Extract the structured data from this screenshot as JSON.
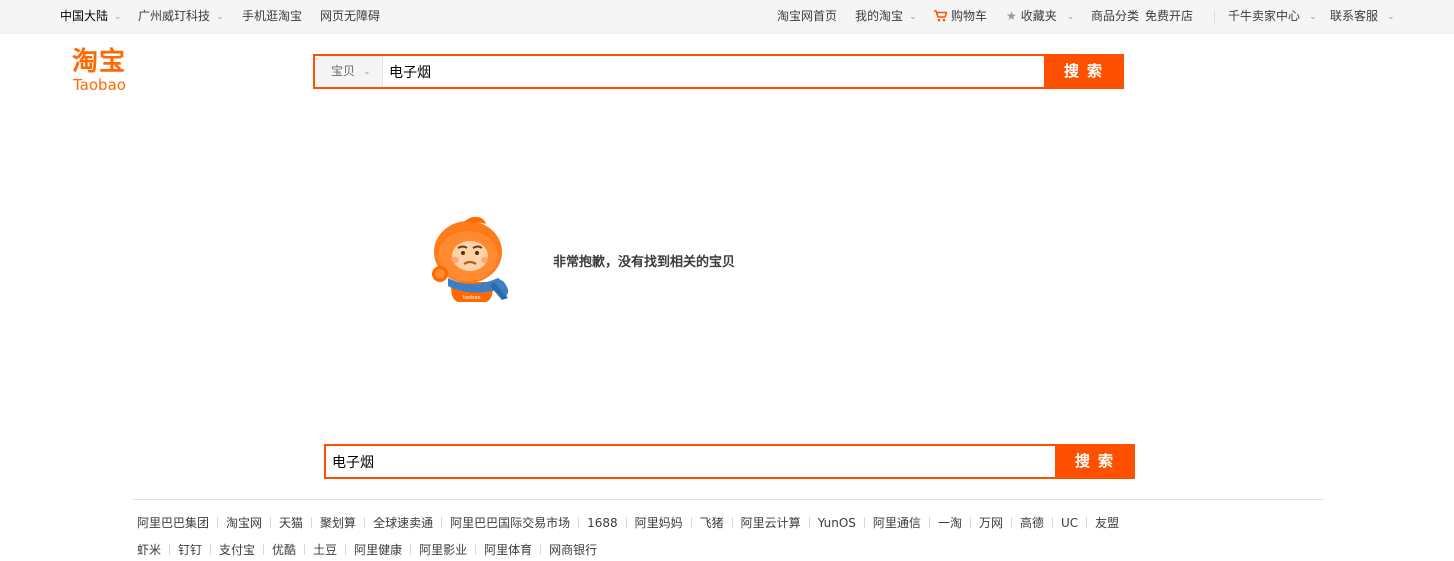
{
  "topnav": {
    "left": [
      {
        "label": "中国大陆",
        "caret": true
      },
      {
        "label": "广州威玎科技",
        "caret": true
      },
      {
        "label": "手机逛淘宝",
        "caret": false
      },
      {
        "label": "网页无障碍",
        "caret": false
      }
    ],
    "right": [
      {
        "label": "淘宝网首页"
      },
      {
        "label": "我的淘宝"
      },
      {
        "label": "购物车"
      },
      {
        "label": "收藏夹"
      },
      {
        "label": "商品分类"
      },
      {
        "label": "免费开店"
      },
      {
        "label": "千牛卖家中心"
      },
      {
        "label": "联系客服"
      }
    ]
  },
  "logo": {
    "cn": "淘宝",
    "en": "Taobao"
  },
  "search_top": {
    "type_label": "宝贝",
    "query": "电子烟",
    "button": "搜索"
  },
  "empty_message": "非常抱歉，没有找到相关的宝贝",
  "search_bottom": {
    "query": "电子烟",
    "button": "搜索"
  },
  "footer": {
    "row1": [
      "阿里巴巴集团",
      "淘宝网",
      "天猫",
      "聚划算",
      "全球速卖通",
      "阿里巴巴国际交易市场",
      "1688",
      "阿里妈妈",
      "飞猪",
      "阿里云计算",
      "YunOS",
      "阿里通信",
      "一淘",
      "万网",
      "高德",
      "UC",
      "友盟"
    ],
    "row2": [
      "虾米",
      "钉钉",
      "支付宝",
      "优酷",
      "土豆",
      "阿里健康",
      "阿里影业",
      "阿里体育",
      "网商银行"
    ]
  },
  "colors": {
    "brand": "#ff5000",
    "logo": "#ff6a00"
  },
  "icons": [
    "cart-icon",
    "star-icon",
    "chevron-down-icon",
    "taobao-mascot-icon"
  ]
}
